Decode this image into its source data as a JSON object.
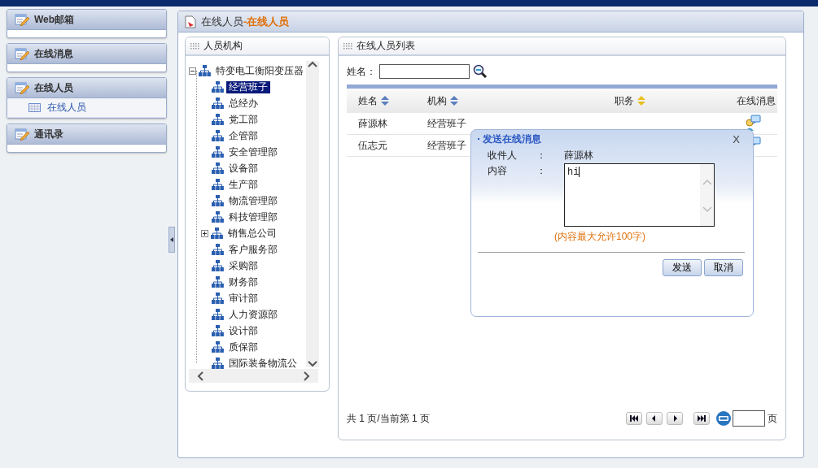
{
  "sidebar": {
    "sections": [
      {
        "title": "Web邮箱"
      },
      {
        "title": "在线消息"
      },
      {
        "title": "在线人员",
        "items": [
          {
            "label": "在线人员"
          }
        ]
      },
      {
        "title": "通讯录"
      }
    ]
  },
  "main": {
    "title": "在线人员",
    "subtitle": "-在线人员"
  },
  "org_panel": {
    "title": "人员机构",
    "tree": {
      "label": "特变电工衡阳变压器",
      "expanded": true,
      "selected": false,
      "children": [
        {
          "label": "经营班子",
          "selected": true,
          "kind": "leaf"
        },
        {
          "label": "总经办",
          "selected": false,
          "kind": "leaf"
        },
        {
          "label": "党工部",
          "selected": false,
          "kind": "leaf"
        },
        {
          "label": "企管部",
          "selected": false,
          "kind": "leaf"
        },
        {
          "label": "安全管理部",
          "selected": false,
          "kind": "leaf"
        },
        {
          "label": "设备部",
          "selected": false,
          "kind": "leaf"
        },
        {
          "label": "生产部",
          "selected": false,
          "kind": "leaf"
        },
        {
          "label": "物流管理部",
          "selected": false,
          "kind": "leaf"
        },
        {
          "label": "科技管理部",
          "selected": false,
          "kind": "leaf"
        },
        {
          "label": "销售总公司",
          "selected": false,
          "kind": "collapsed"
        },
        {
          "label": "客户服务部",
          "selected": false,
          "kind": "leaf"
        },
        {
          "label": "采购部",
          "selected": false,
          "kind": "leaf"
        },
        {
          "label": "财务部",
          "selected": false,
          "kind": "leaf"
        },
        {
          "label": "审计部",
          "selected": false,
          "kind": "leaf"
        },
        {
          "label": "人力资源部",
          "selected": false,
          "kind": "leaf"
        },
        {
          "label": "设计部",
          "selected": false,
          "kind": "leaf"
        },
        {
          "label": "质保部",
          "selected": false,
          "kind": "leaf"
        },
        {
          "label": "国际装备物流公",
          "selected": false,
          "kind": "leaf"
        }
      ]
    }
  },
  "list_panel": {
    "title": "在线人员列表",
    "search": {
      "label": "姓名："
    },
    "columns": [
      {
        "label": "姓名",
        "kind": "sortable",
        "sorted": false
      },
      {
        "label": "机构",
        "kind": "sortable",
        "sorted": false
      },
      {
        "label": "职务",
        "kind": "sortable",
        "sorted": true
      },
      {
        "label": "在线消息",
        "kind": "plain"
      }
    ],
    "rows": [
      {
        "name": "薛源林",
        "org": "经营班子"
      },
      {
        "name": "伍志元",
        "org": "经营班子"
      }
    ],
    "pager": {
      "summary": "共 1 页/当前第 1 页",
      "unit": "页"
    }
  },
  "dialog": {
    "title": "发送在线消息",
    "close": "X",
    "fields": [
      {
        "kind": "text",
        "label": "收件人",
        "sep": "：",
        "value": "薛源林"
      },
      {
        "kind": "textarea",
        "label": "内容",
        "sep": "：",
        "value": "hi"
      }
    ],
    "hint": "(内容最大允许100字)",
    "buttons": [
      "发送",
      "取消"
    ]
  }
}
